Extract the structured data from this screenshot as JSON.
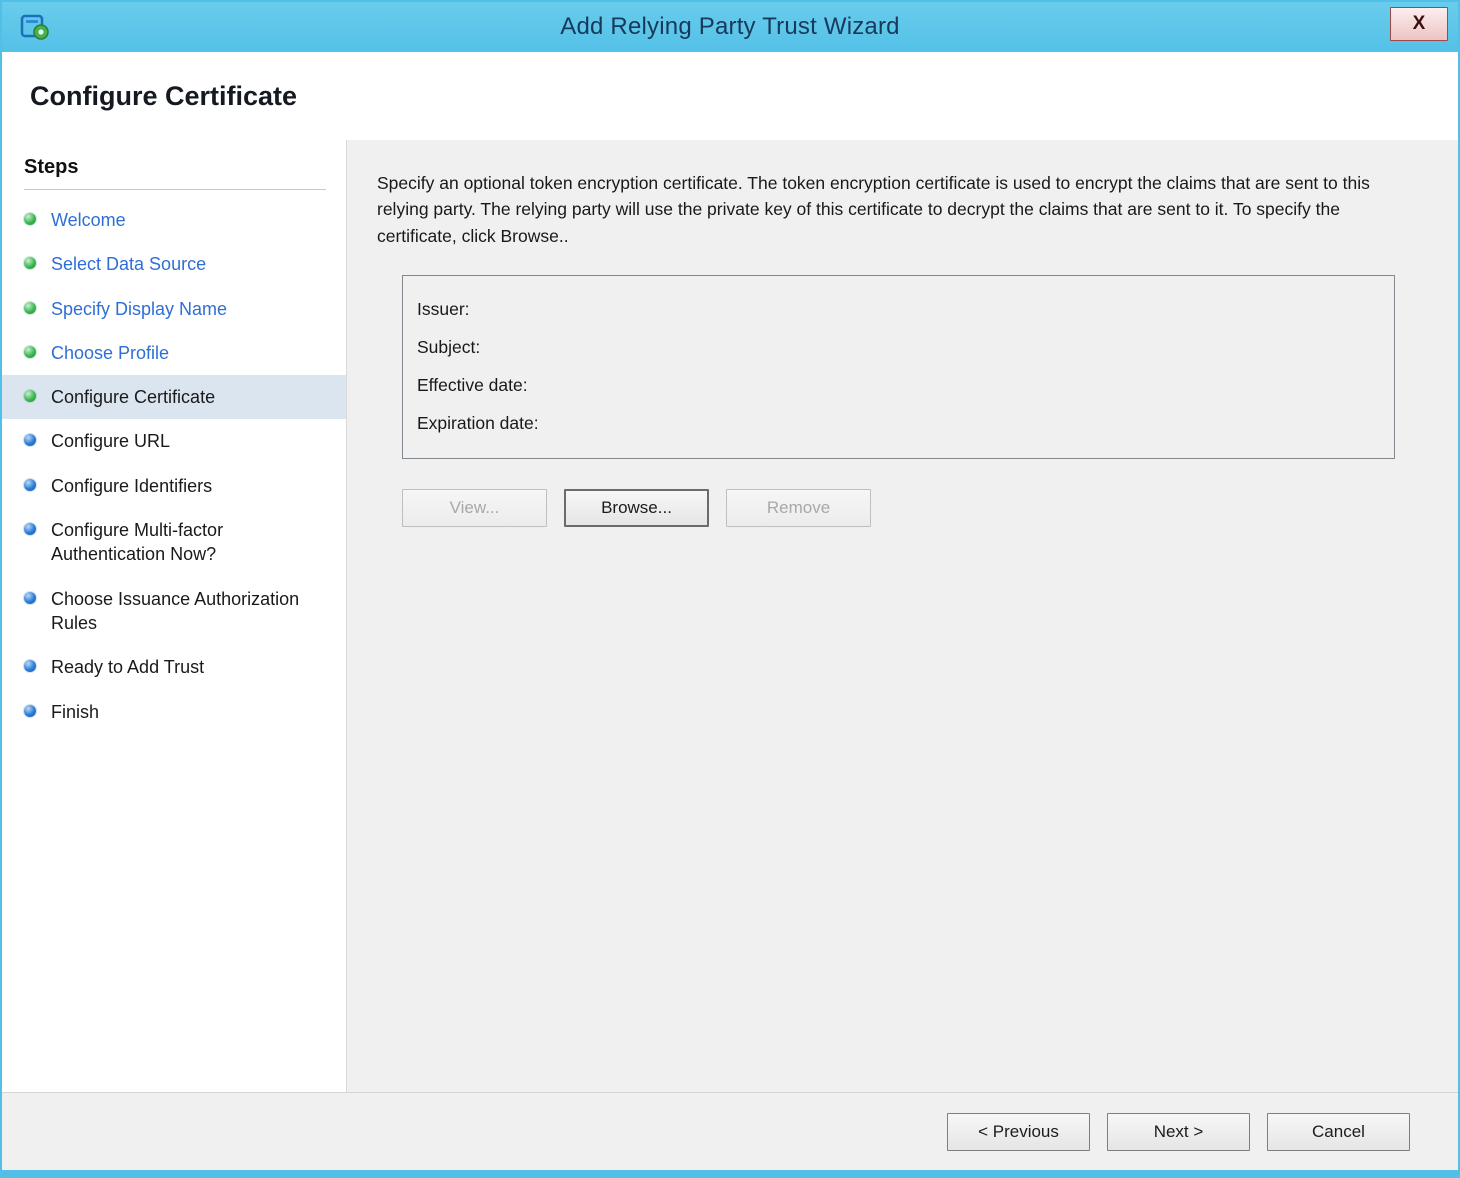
{
  "window": {
    "title": "Add Relying Party Trust Wizard",
    "close_label": "X"
  },
  "header": {
    "title": "Configure Certificate"
  },
  "sidebar": {
    "title": "Steps",
    "items": [
      {
        "label": "Welcome",
        "state": "done"
      },
      {
        "label": "Select Data Source",
        "state": "done"
      },
      {
        "label": "Specify Display Name",
        "state": "done"
      },
      {
        "label": "Choose Profile",
        "state": "done"
      },
      {
        "label": "Configure Certificate",
        "state": "current"
      },
      {
        "label": "Configure URL",
        "state": "todo"
      },
      {
        "label": "Configure Identifiers",
        "state": "todo"
      },
      {
        "label": "Configure Multi-factor Authentication Now?",
        "state": "todo"
      },
      {
        "label": "Choose Issuance Authorization Rules",
        "state": "todo"
      },
      {
        "label": "Ready to Add Trust",
        "state": "todo"
      },
      {
        "label": "Finish",
        "state": "todo"
      }
    ]
  },
  "main": {
    "description": "Specify an optional token encryption certificate.  The token encryption certificate is used to encrypt the claims that are sent to this relying party.  The relying party will use the private key of this certificate to decrypt the claims that are sent to it.  To specify the certificate, click Browse..",
    "certificate_box": {
      "fields": [
        {
          "label": "Issuer:",
          "value": ""
        },
        {
          "label": "Subject:",
          "value": ""
        },
        {
          "label": "Effective date:",
          "value": ""
        },
        {
          "label": "Expiration date:",
          "value": ""
        }
      ]
    },
    "buttons": [
      {
        "label": "View...",
        "enabled": false
      },
      {
        "label": "Browse...",
        "enabled": true,
        "focused": true
      },
      {
        "label": "Remove",
        "enabled": false
      }
    ]
  },
  "footer": {
    "buttons": [
      {
        "label": "< Previous"
      },
      {
        "label": "Next >"
      },
      {
        "label": "Cancel"
      }
    ]
  },
  "colors": {
    "titlebar": "#5bc6e9",
    "title_text": "#17395c",
    "link_blue": "#2e6fd6",
    "bullet_done": "#3cb553",
    "bullet_todo": "#2a7ad8",
    "current_step_highlight": "#dbe5f0",
    "content_background": "#f0f0f0",
    "window_border": "#52bfe6"
  }
}
